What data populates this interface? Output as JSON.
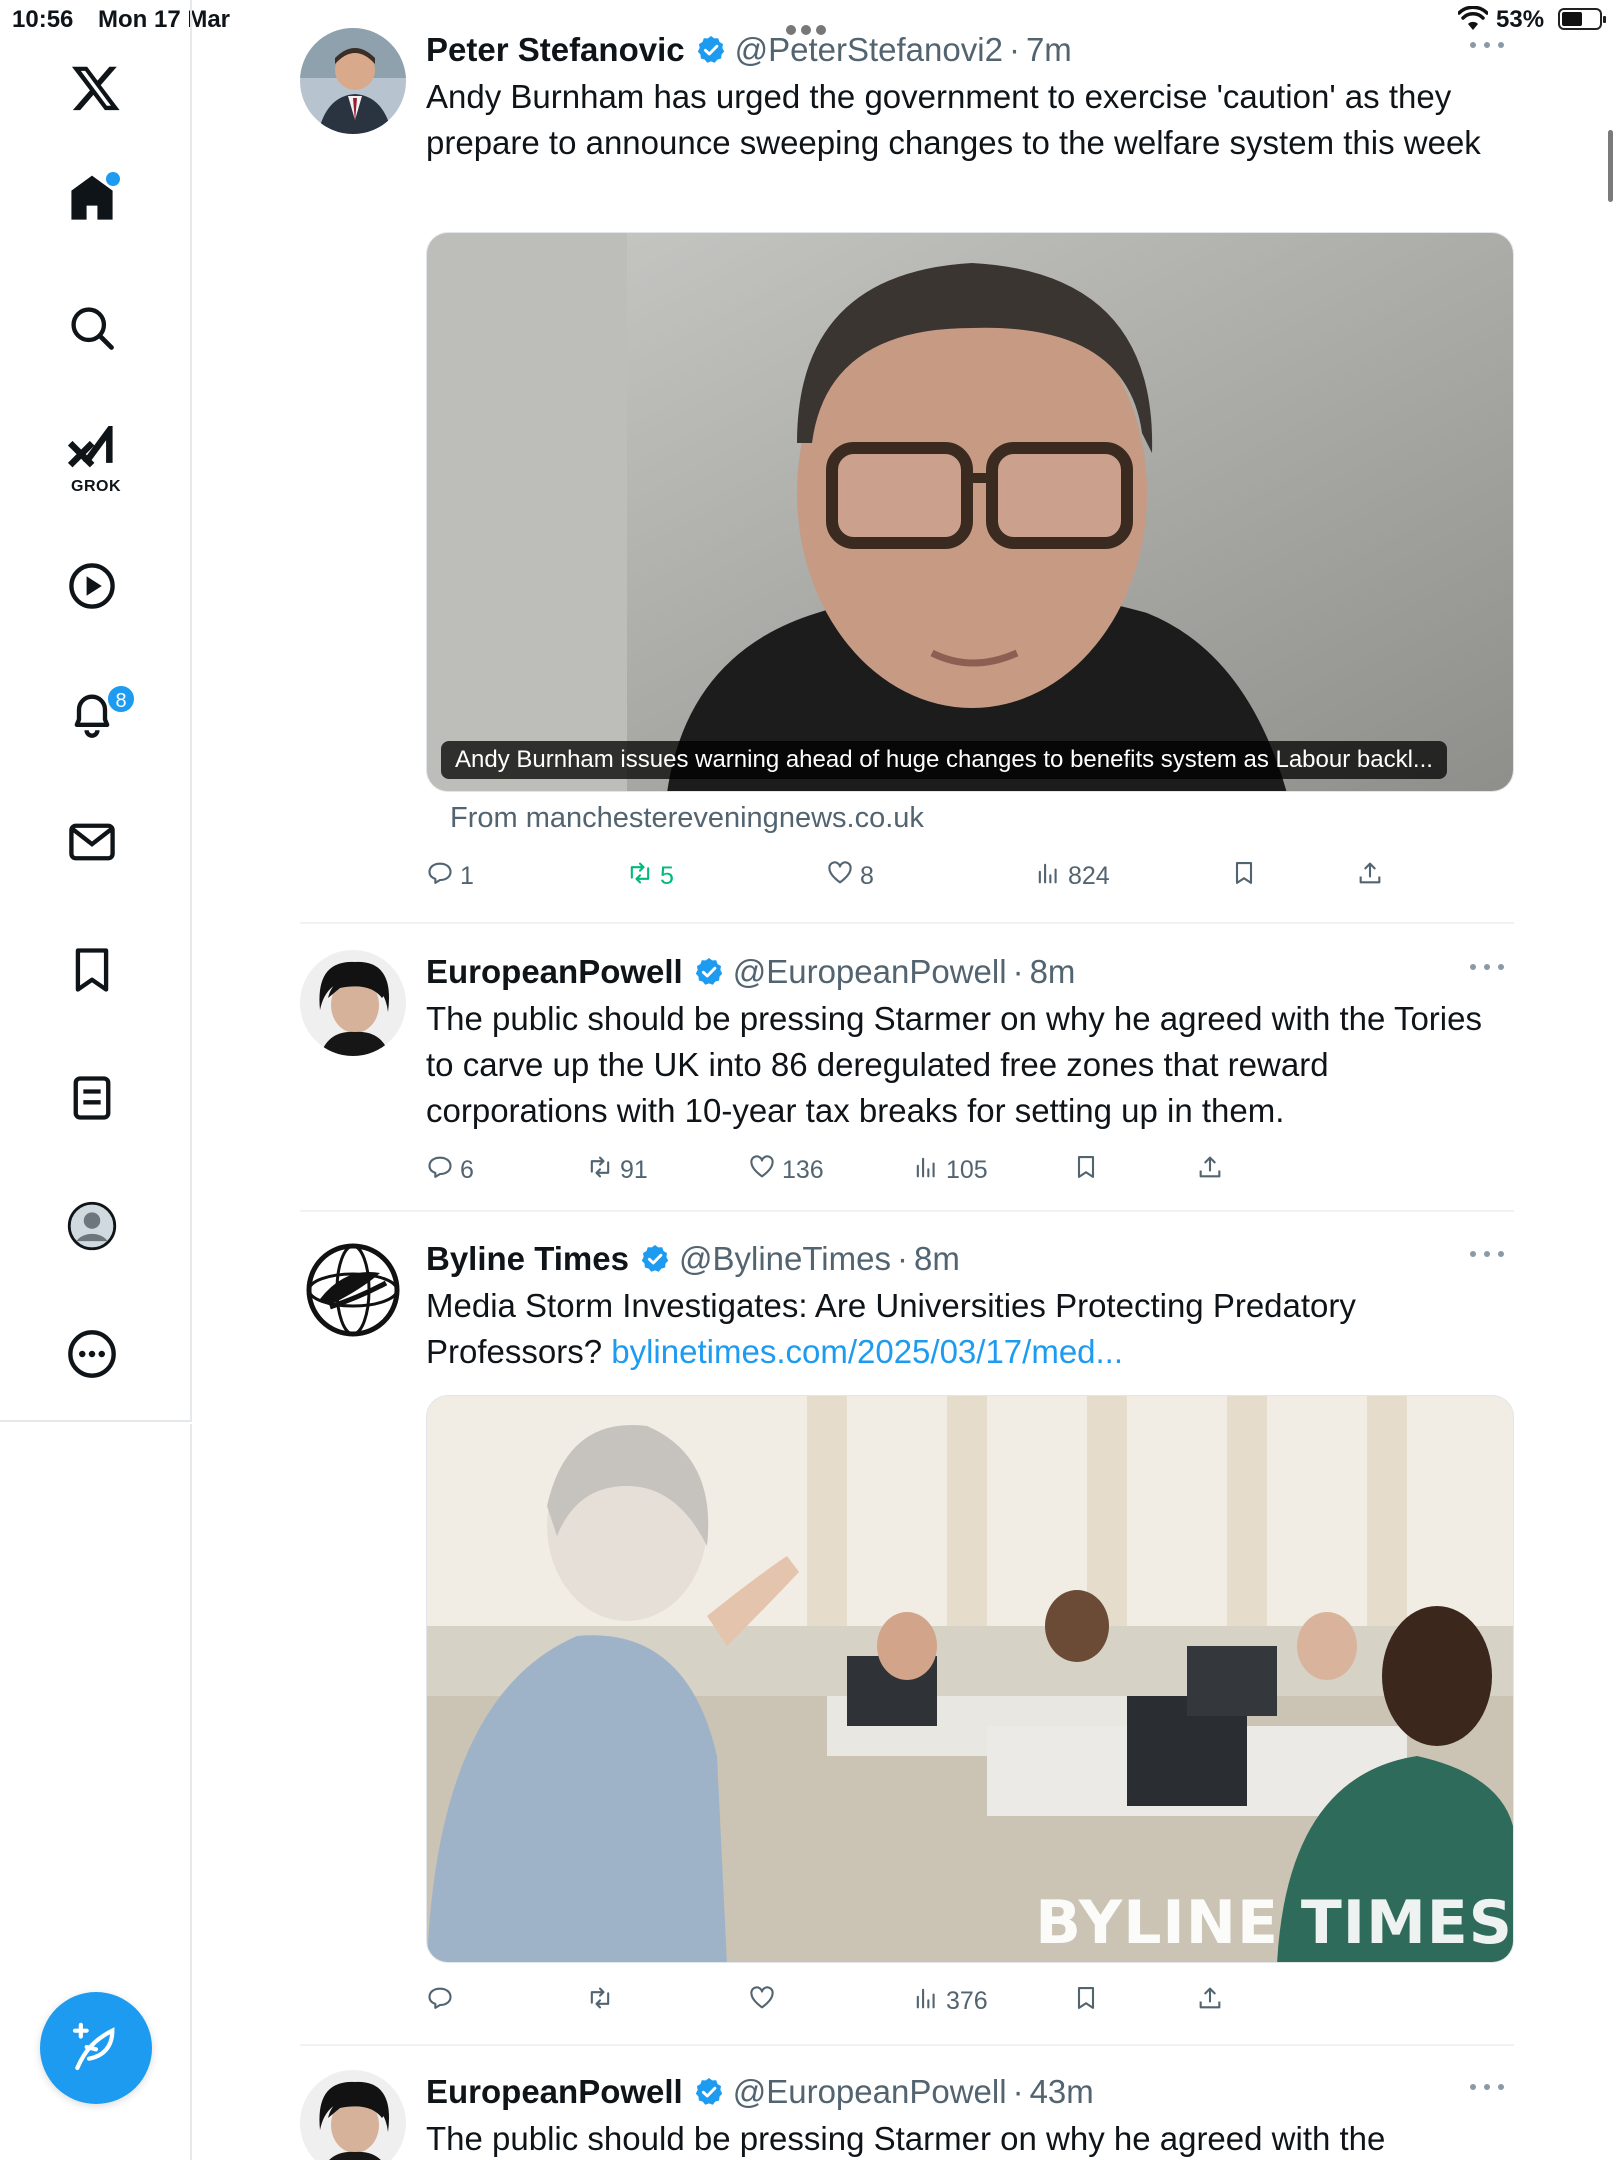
{
  "status_bar": {
    "time": "10:56",
    "date": "Mon 17 Mar",
    "battery_percent": "53%",
    "battery_level": 0.53
  },
  "sidebar": {
    "items": [
      {
        "name": "home",
        "icon": "home-icon",
        "active": true
      },
      {
        "name": "explore",
        "icon": "search-icon"
      },
      {
        "name": "grok",
        "icon": "grok-icon",
        "label": "GROK"
      },
      {
        "name": "videos",
        "icon": "play-icon"
      },
      {
        "name": "notifications",
        "icon": "bell-icon",
        "badge": "8"
      },
      {
        "name": "messages",
        "icon": "mail-icon"
      },
      {
        "name": "bookmarks",
        "icon": "bookmark-icon"
      },
      {
        "name": "lists",
        "icon": "list-icon"
      },
      {
        "name": "profile",
        "icon": "profile-icon"
      },
      {
        "name": "more",
        "icon": "more-icon"
      }
    ],
    "compose_icon": "compose-feather-icon"
  },
  "accent_color": "#1d9bf0",
  "retweet_active_color": "#00ba7c",
  "tweets": [
    {
      "name": "Peter Stefanovic",
      "handle": "@PeterStefanovi2",
      "separator": "·",
      "time": "7m",
      "verified": true,
      "text": "Andy Burnham has urged the government to exercise 'caution' as they prepare to announce sweeping changes to the welfare system this week",
      "card_caption": "Andy Burnham issues warning ahead of huge changes to benefits system as Labour backl...",
      "card_source": "From manchestereveningnews.co.uk",
      "replies": "1",
      "retweets": "5",
      "likes": "8",
      "views": "824",
      "retweeted": true
    },
    {
      "name": "EuropeanPowell",
      "handle": "@EuropeanPowell",
      "separator": "·",
      "time": "8m",
      "verified": true,
      "text": "The public should be pressing Starmer on why he agreed with the Tories to carve up the UK into 86 deregulated free zones that reward corporations with 10-year tax breaks for setting up in them.",
      "replies": "6",
      "retweets": "91",
      "likes": "136",
      "views": "105"
    },
    {
      "name": "Byline Times",
      "handle": "@BylineTimes",
      "separator": "·",
      "time": "8m",
      "verified": true,
      "text": "Media Storm Investigates: Are Universities Protecting Predatory Professors?",
      "link": "bylinetimes.com/2025/03/17/med...",
      "image_watermark": "BYLINE TIMES",
      "views": "376"
    },
    {
      "name": "EuropeanPowell",
      "handle": "@EuropeanPowell",
      "separator": "·",
      "time": "43m",
      "verified": true,
      "text": "The public should be pressing Starmer on why he agreed with the"
    }
  ]
}
